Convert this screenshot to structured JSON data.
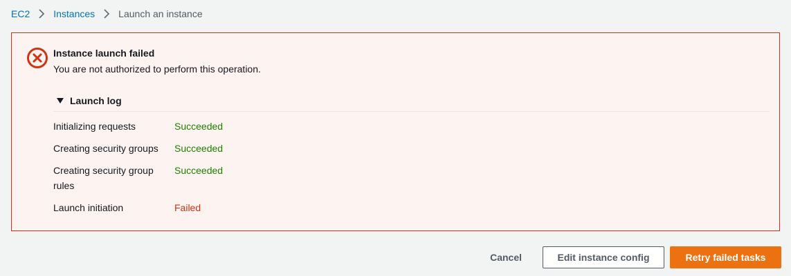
{
  "breadcrumb": {
    "items": [
      {
        "label": "EC2"
      },
      {
        "label": "Instances"
      },
      {
        "label": "Launch an instance"
      }
    ]
  },
  "alert": {
    "type": "error",
    "icon": "error-circle-x-icon",
    "title": "Instance launch failed",
    "message": "You are not authorized to perform this operation."
  },
  "launch_log": {
    "label": "Launch log",
    "expanded": true,
    "rows": [
      {
        "task": "Initializing requests",
        "status": "Succeeded"
      },
      {
        "task": "Creating security groups",
        "status": "Succeeded"
      },
      {
        "task": "Creating security group rules",
        "status": "Succeeded"
      },
      {
        "task": "Launch initiation",
        "status": "Failed"
      }
    ]
  },
  "footer": {
    "cancel_label": "Cancel",
    "edit_label": "Edit instance config",
    "retry_label": "Retry failed tasks"
  },
  "colors": {
    "link": "#0073bb",
    "error": "#d13212",
    "success": "#1d8102",
    "primary": "#ec7211",
    "alert_bg": "#fdf3f1"
  }
}
